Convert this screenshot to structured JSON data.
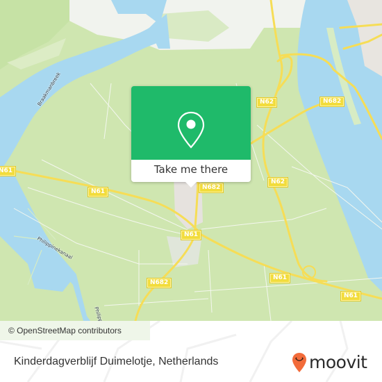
{
  "map": {
    "road_labels": [
      {
        "id": "n62-top",
        "text": "N62"
      },
      {
        "id": "n682-top",
        "text": "N682"
      },
      {
        "id": "n62-mid",
        "text": "N62"
      },
      {
        "id": "n682-center",
        "text": "N682"
      },
      {
        "id": "n62-right",
        "text": "N62"
      },
      {
        "id": "n61-left-edge",
        "text": "N61"
      },
      {
        "id": "n61-left",
        "text": "N61"
      },
      {
        "id": "n61-center",
        "text": "N61"
      },
      {
        "id": "n682-bottom",
        "text": "N682"
      },
      {
        "id": "n61-bottom",
        "text": "N61"
      },
      {
        "id": "n61-right",
        "text": "N61"
      }
    ],
    "water_labels": [
      {
        "id": "braakmanbreek",
        "text": "Braakmanbreek"
      },
      {
        "id": "philippinekanaal",
        "text": "Philippinekanaal"
      },
      {
        "id": "philippinekanaal-2",
        "text": "Philippin"
      }
    ],
    "colors": {
      "land": "#cfe6b0",
      "water": "#a8d8f0",
      "road": "#f6dd56",
      "industrial": "#f1f3ee",
      "urban": "#e6e2de"
    }
  },
  "popup": {
    "button_label": "Take me there",
    "icon": "map-pin-icon",
    "accent": "#1fba6a"
  },
  "attribution": "© OpenStreetMap contributors",
  "footer": {
    "place_name": "Kinderdagverblijf Duimelotje, Netherlands",
    "brand": "moovit",
    "brand_color": "#f26b3a"
  }
}
